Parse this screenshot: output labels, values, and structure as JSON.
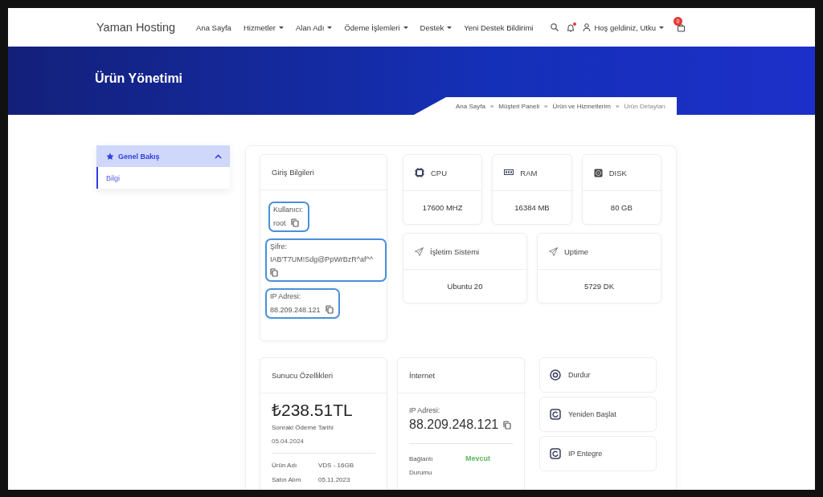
{
  "brand": "Yaman Hosting",
  "nav": [
    {
      "label": "Ana Sayfa",
      "dropdown": false
    },
    {
      "label": "Hizmetler",
      "dropdown": true
    },
    {
      "label": "Alan Adı",
      "dropdown": true
    },
    {
      "label": "Ödeme İşlemleri",
      "dropdown": true
    },
    {
      "label": "Destek",
      "dropdown": true
    },
    {
      "label": "Yeni Destek Bildirimi",
      "dropdown": false
    }
  ],
  "user_menu": {
    "greeting": "Hoş geldiniz, Utku",
    "notification": true
  },
  "cart": {
    "count": "0"
  },
  "page_title": "Ürün Yönetimi",
  "breadcrumb_separator": "»",
  "breadcrumb": [
    "Ana Sayfa",
    "Müşteri Paneli",
    "Ürün ve Hizmetlerim",
    "Ürün Detayları"
  ],
  "sidebar": {
    "title": "Genel Bakış",
    "expanded": true,
    "items": [
      {
        "label": "Bilgi",
        "selected": true
      }
    ]
  },
  "login": {
    "title": "Giriş Bilgileri",
    "fields": [
      {
        "label": "Kullanıcı:",
        "value": "root"
      },
      {
        "label": "Şifre:",
        "value": "IAB'T7UM!Sdg@PpWrBzR^af^^"
      },
      {
        "label": "IP Adresi:",
        "value": "88.209.248.121"
      }
    ]
  },
  "specs": [
    {
      "kind": "cpu",
      "label": "CPU",
      "value": "17600 MHZ"
    },
    {
      "kind": "ram",
      "label": "RAM",
      "value": "16384 MB"
    },
    {
      "kind": "disk",
      "label": "DISK",
      "value": "80 GB"
    },
    {
      "kind": "send",
      "label": "İşletim Sistemi",
      "value": "Ubuntu 20"
    },
    {
      "kind": "send",
      "label": "Uptime",
      "value": "5729 DK"
    }
  ],
  "server": {
    "title": "Sunucu Özellikleri",
    "price": "₺238.51TL",
    "next_label": "Sonraki Ödeme Tarihi",
    "next_date": "05.04.2024",
    "rows": [
      {
        "label": "Ürün Adı",
        "value": "VDS - 16GB"
      },
      {
        "label": "Satın Alım",
        "value": "05.11.2023"
      }
    ]
  },
  "internet": {
    "title": "İnternet",
    "ip_label": "IP Adresi:",
    "ip": "88.209.248.121",
    "rows": [
      {
        "label": "Bağlantı Durumu",
        "value": "Mevcut",
        "color": "#5cb85c"
      }
    ]
  },
  "actions": [
    {
      "kind": "stop",
      "label": "Durdur"
    },
    {
      "kind": "restart",
      "label": "Yeniden Başlat"
    },
    {
      "kind": "restart",
      "label": "IP Entegre"
    }
  ]
}
